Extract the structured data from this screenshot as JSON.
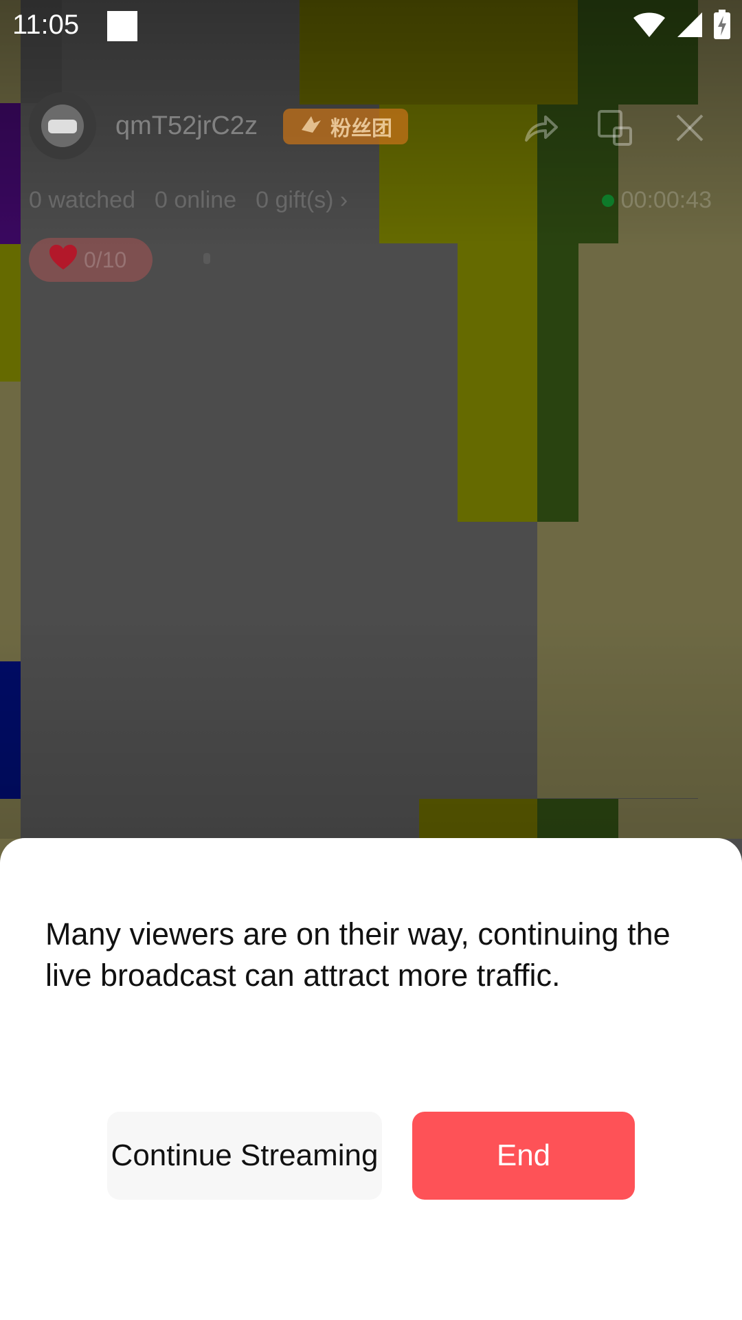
{
  "status_bar": {
    "time": "11:05",
    "icons": [
      "notification-square-icon",
      "wifi-icon",
      "cell-signal-icon",
      "battery-charging-icon"
    ]
  },
  "live_header": {
    "username": "qmT52jrC2z",
    "fan_badge_label": "粉丝团",
    "stats": {
      "watched": "0 watched",
      "online": "0 online",
      "gifts": "0 gift(s)",
      "gifts_chevron": "›"
    },
    "timer": "00:00:43",
    "likes": "0/10",
    "icons": [
      "share-icon",
      "screen-switch-icon",
      "close-icon"
    ]
  },
  "dialog": {
    "message": "Many viewers are on their way, continuing the live broadcast can attract more traffic.",
    "continue_label": "Continue Streaming",
    "end_label": "End"
  },
  "colors": {
    "end_button": "#fe5257",
    "continue_button": "#f7f7f7",
    "sheet_background": "#ffffff"
  }
}
